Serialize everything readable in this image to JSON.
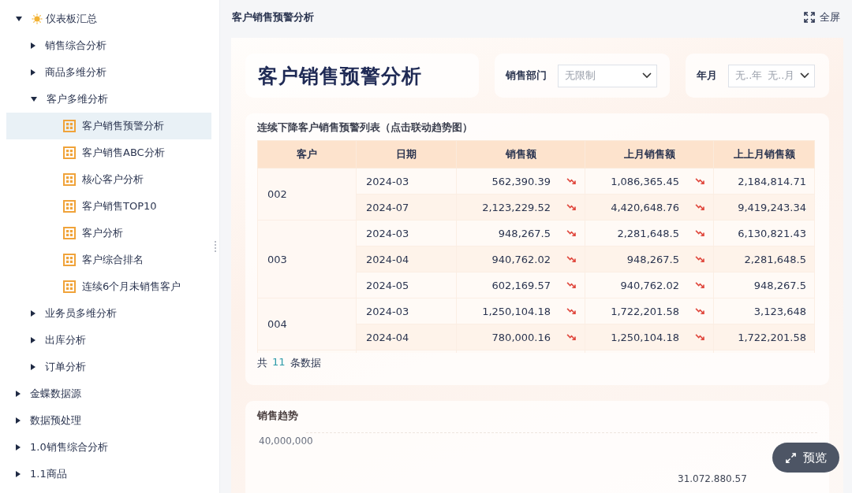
{
  "sidebar": {
    "tree": [
      {
        "label": "仪表板汇总",
        "kind": "featured",
        "expanded": true,
        "selected": false,
        "children": [
          {
            "label": "销售综合分析",
            "kind": "folder",
            "expanded": false,
            "selected": false
          },
          {
            "label": "商品多维分析",
            "kind": "folder",
            "expanded": false,
            "selected": false
          },
          {
            "label": "客户多维分析",
            "kind": "folder",
            "expanded": true,
            "selected": false,
            "children": [
              {
                "label": "客户销售预警分析",
                "kind": "dashboard",
                "selected": true
              },
              {
                "label": "客户销售ABC分析",
                "kind": "dashboard",
                "selected": false
              },
              {
                "label": "核心客户分析",
                "kind": "dashboard",
                "selected": false
              },
              {
                "label": "客户销售TOP10",
                "kind": "dashboard",
                "selected": false
              },
              {
                "label": "客户分析",
                "kind": "dashboard",
                "selected": false
              },
              {
                "label": "客户综合排名",
                "kind": "dashboard",
                "selected": false
              },
              {
                "label": "连续6个月未销售客户",
                "kind": "dashboard",
                "selected": false
              }
            ]
          },
          {
            "label": "业务员多维分析",
            "kind": "folder",
            "expanded": false,
            "selected": false
          },
          {
            "label": "出库分析",
            "kind": "folder",
            "expanded": false,
            "selected": false
          },
          {
            "label": "订单分析",
            "kind": "folder",
            "expanded": false,
            "selected": false
          }
        ]
      },
      {
        "label": "金蝶数据源",
        "kind": "folder",
        "expanded": false,
        "selected": false
      },
      {
        "label": "数据预处理",
        "kind": "folder",
        "expanded": false,
        "selected": false
      },
      {
        "label": "1.0销售综合分析",
        "kind": "folder",
        "expanded": false,
        "selected": false
      },
      {
        "label": "1.1商品",
        "kind": "folder",
        "expanded": false,
        "selected": false
      }
    ]
  },
  "header": {
    "title": "客户销售预警分析",
    "fullscreen": "全屏"
  },
  "dashboard": {
    "title": "客户销售预警分析",
    "filters": [
      {
        "label": "销售部门",
        "kind": "single",
        "placeholder": "无限制"
      },
      {
        "label": "年月",
        "kind": "range",
        "placeholders": [
          "无..年",
          "无..月"
        ]
      }
    ],
    "table": {
      "title": "连续下降客户销售预警列表（点击联动趋势图）",
      "columns": [
        "客户",
        "日期",
        "销售额",
        "上月销售额",
        "上上月销售额"
      ],
      "groups": [
        {
          "customer": "002",
          "rows": [
            {
              "date": "2024-03",
              "sales": "562,390.39",
              "last": "1,086,365.45",
              "last2": "2,184,814.71"
            },
            {
              "date": "2024-07",
              "sales": "2,123,229.52",
              "last": "4,420,648.76",
              "last2": "9,419,243.34"
            }
          ]
        },
        {
          "customer": "003",
          "rows": [
            {
              "date": "2024-03",
              "sales": "948,267.5",
              "last": "2,281,648.5",
              "last2": "6,130,821.43"
            },
            {
              "date": "2024-04",
              "sales": "940,762.02",
              "last": "948,267.5",
              "last2": "2,281,648.5"
            },
            {
              "date": "2024-05",
              "sales": "602,169.57",
              "last": "940,762.02",
              "last2": "948,267.5"
            }
          ]
        },
        {
          "customer": "004",
          "rows": [
            {
              "date": "2024-03",
              "sales": "1,250,104.18",
              "last": "1,722,201.58",
              "last2": "3,123,648"
            },
            {
              "date": "2024-04",
              "sales": "780,000.16",
              "last": "1,250,104.18",
              "last2": "1,722,201.58"
            }
          ]
        }
      ],
      "footer": {
        "prefix": "共",
        "count": "11",
        "suffix": "条数据"
      }
    },
    "trend": {
      "title": "销售趋势",
      "axis_label": "40,000,000",
      "data_label": "31.072.880.57"
    }
  },
  "preview_button": "预览"
}
